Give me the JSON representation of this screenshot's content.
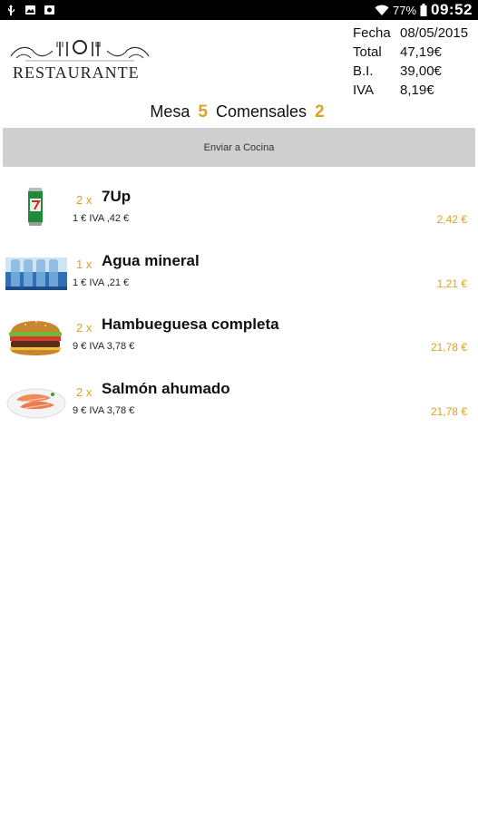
{
  "status_bar": {
    "battery": "77%",
    "time": "09:52"
  },
  "logo": {
    "text": "RESTAURANTE"
  },
  "summary": {
    "fecha_label": "Fecha",
    "fecha_value": "08/05/2015",
    "total_label": "Total",
    "total_value": "47,19€",
    "bi_label": "B.I.",
    "bi_value": "39,00€",
    "iva_label": "IVA",
    "iva_value": "8,19€"
  },
  "table": {
    "mesa_label": "Mesa",
    "mesa_value": "5",
    "comensales_label": "Comensales",
    "comensales_value": "2"
  },
  "send_button_label": "Enviar a Cocina",
  "items": [
    {
      "qty": "2 x",
      "name": "7Up",
      "unit": "1 € IVA ,42 €",
      "total": "2,42 €",
      "icon": "soda-can-icon"
    },
    {
      "qty": "1 x",
      "name": "Agua mineral",
      "unit": "1 € IVA ,21 €",
      "total": "1,21 €",
      "icon": "water-bottles-icon"
    },
    {
      "qty": "2 x",
      "name": "Hambueguesa completa",
      "unit": "9 € IVA 3,78 €",
      "total": "21,78 €",
      "icon": "burger-icon"
    },
    {
      "qty": "2 x",
      "name": "Salmón ahumado",
      "unit": "9 € IVA 3,78 €",
      "total": "21,78 €",
      "icon": "salmon-icon"
    }
  ],
  "colors": {
    "accent": "#e0a020",
    "button_bg": "#cfcfcf",
    "status_bar": "#000000"
  }
}
